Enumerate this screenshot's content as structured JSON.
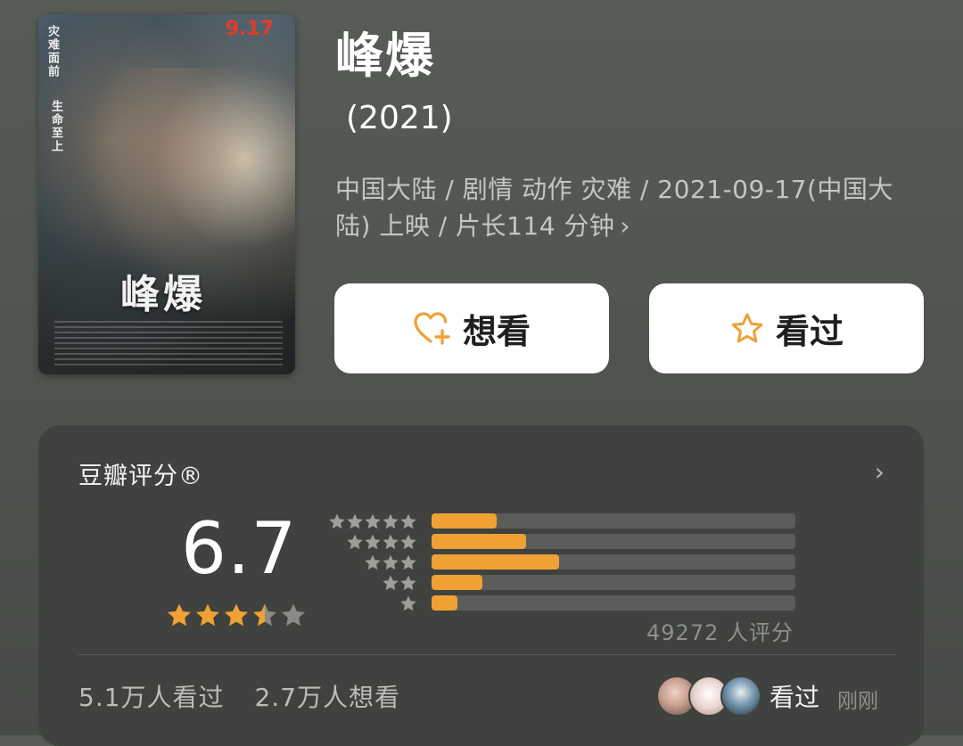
{
  "poster": {
    "tagline_line1": "灾难面前",
    "tagline_line2": "生命至上",
    "release_badge": "9.17",
    "title_art": "峰爆"
  },
  "movie": {
    "title": "峰爆",
    "year": "(2021)",
    "meta": "中国大陆 / 剧情 动作 灾难 / 2021-09-17(中国大陆) 上映 / 片长114 分钟",
    "meta_chevron": "›"
  },
  "actions": {
    "want_label": "想看",
    "want_icon": "heart-plus-icon",
    "seen_label": "看过",
    "seen_icon": "star-outline-icon",
    "icon_color": "#efa135"
  },
  "rating": {
    "title": "豆瓣评分®",
    "chevron": "›",
    "score": "6.7",
    "score_stars": 3.5,
    "distribution": [
      {
        "stars": 5,
        "fraction": 0.18
      },
      {
        "stars": 4,
        "fraction": 0.26
      },
      {
        "stars": 3,
        "fraction": 0.35
      },
      {
        "stars": 2,
        "fraction": 0.14
      },
      {
        "stars": 1,
        "fraction": 0.07
      }
    ],
    "count_text": "49272 人评分",
    "colors": {
      "accent": "#efa135",
      "star_empty": "#8a8a86",
      "track": "#5a5d59"
    }
  },
  "footer": {
    "seen_count": "5.1万人看过",
    "want_count": "2.7万人想看",
    "friends_label": "看过",
    "friends_time": "刚刚"
  }
}
